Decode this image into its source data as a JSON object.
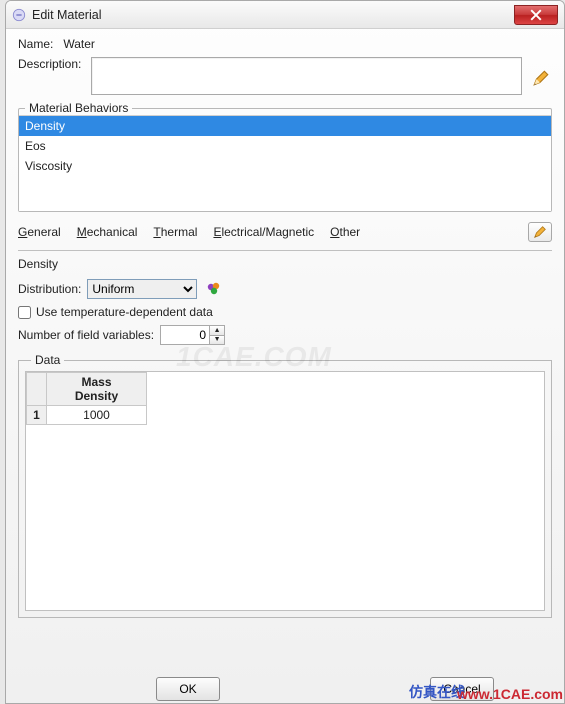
{
  "titlebar": {
    "title": "Edit Material"
  },
  "name": {
    "label": "Name:",
    "value": "Water"
  },
  "description": {
    "label": "Description:",
    "value": ""
  },
  "behaviors": {
    "legend": "Material Behaviors",
    "items": [
      {
        "label": "Density",
        "selected": true
      },
      {
        "label": "Eos",
        "selected": false
      },
      {
        "label": "Viscosity",
        "selected": false
      }
    ]
  },
  "tabs": {
    "general": "General",
    "mechanical": "Mechanical",
    "thermal": "Thermal",
    "electrical": "Electrical/Magnetic",
    "other": "Other"
  },
  "section": {
    "title": "Density"
  },
  "distribution": {
    "label": "Distribution:",
    "value": "Uniform"
  },
  "temp_dep": {
    "label": "Use temperature-dependent data",
    "checked": false
  },
  "field_vars": {
    "label": "Number of field variables:",
    "value": "0"
  },
  "data": {
    "legend": "Data",
    "header": "Mass\nDensity",
    "rows": [
      {
        "n": "1",
        "mass_density": "1000"
      }
    ]
  },
  "buttons": {
    "ok": "OK",
    "cancel": "Cancel"
  },
  "watermarks": {
    "cn": "仿真在线",
    "url": "www.1CAE.com",
    "ghost": "1CAE.COM"
  }
}
